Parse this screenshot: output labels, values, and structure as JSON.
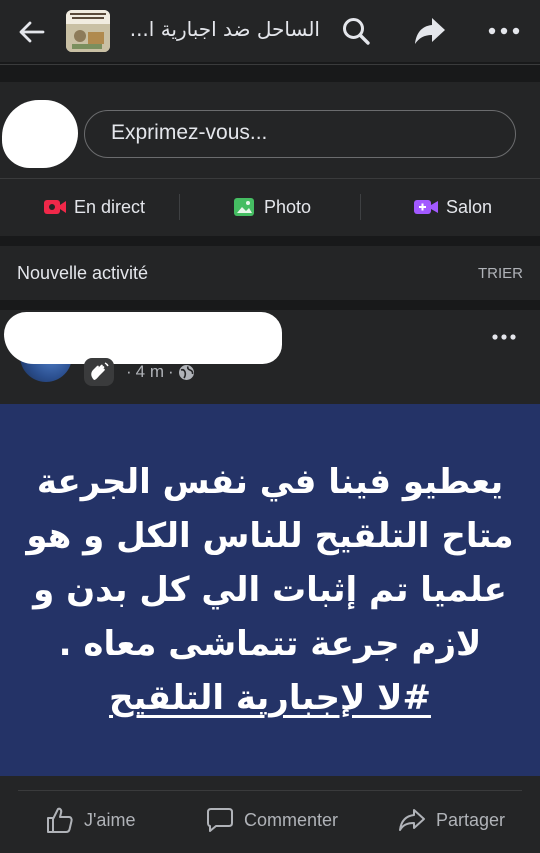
{
  "header": {
    "group_title": "الساحل ضد اجبارية ا...",
    "back_icon": "arrow-left-icon",
    "search_icon": "search-icon",
    "share_icon": "share-icon",
    "more_icon": "more-horizontal-icon"
  },
  "composer": {
    "placeholder": "Exprimez-vous...",
    "actions": [
      {
        "label": "En direct",
        "icon": "live-video-icon",
        "color": "#f02849"
      },
      {
        "label": "Photo",
        "icon": "photo-icon",
        "color": "#45bd62"
      },
      {
        "label": "Salon",
        "icon": "video-room-icon",
        "color": "#a259ff"
      }
    ]
  },
  "activity": {
    "label": "Nouvelle activité",
    "sort_label": "TRIER"
  },
  "post": {
    "time": "4 m",
    "badge_icon": "wave-hand-icon",
    "privacy_icon": "globe-icon",
    "card_background": "#243367",
    "text_lines": [
      "يعطيو فينا في نفس الجرعة",
      "متاح التلقيح للناس الكل و هو",
      "علميا تم إثبات الي كل بدن و",
      "لازم جرعة تتماشى معاه .",
      "#لا لإجبارية التلقيح"
    ],
    "actions": [
      {
        "label": "J'aime",
        "icon": "thumbs-up-icon"
      },
      {
        "label": "Commenter",
        "icon": "comment-icon"
      },
      {
        "label": "Partager",
        "icon": "share-icon"
      }
    ]
  }
}
